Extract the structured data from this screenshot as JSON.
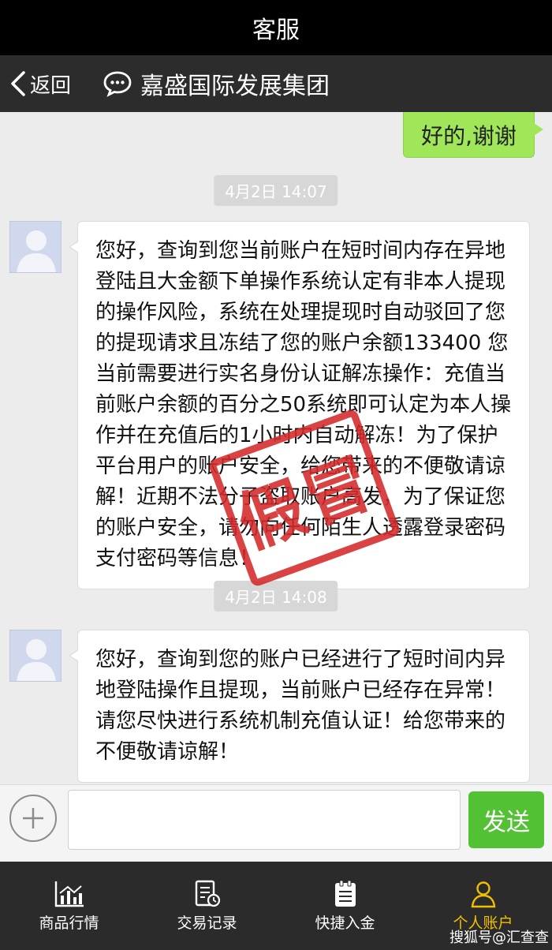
{
  "status_bar": {
    "title": "客服"
  },
  "nav": {
    "back_label": "返回",
    "chat_title": "嘉盛国际发展集团"
  },
  "messages": {
    "outgoing_1": "好的,谢谢",
    "timestamp_1": "4月2日 14:07",
    "incoming_1": "您好，查询到您当前账户在短时间内存在异地登陆且大金额下单操作系统认定有非本人提现的操作风险，系统在处理提现时自动驳回了您的提现请求且冻结了您的账户余额133400 您当前需要进行实名身份认证解冻操作：充值当前账户余额的百分之50系统即可认定为本人操作并在充值后的1小时内自动解冻！为了保护平台用户的账户安全，给您带来的不便敬请谅解！近期不法分子盗取账户高发，为了保证您的账户安全，请勿向任何陌生人透露登录密码支付密码等信息！",
    "timestamp_2": "4月2日 14:08",
    "incoming_2": "您好，查询到您的账户已经进行了短时间内异地登陆操作且提现，当前账户已经存在异常！请您尽快进行系统机制充值认证！给您带来的不便敬请谅解！"
  },
  "stamp": {
    "text": "假冒",
    "color": "#d42a2a"
  },
  "input": {
    "value": "",
    "send_label": "发送"
  },
  "tabs": [
    {
      "label": "商品行情",
      "icon": "chart-icon"
    },
    {
      "label": "交易记录",
      "icon": "record-icon"
    },
    {
      "label": "快捷入金",
      "icon": "deposit-icon"
    },
    {
      "label": "个人账户",
      "icon": "user-icon",
      "active": true
    }
  ],
  "watermark": "搜狐号@汇查查",
  "colors": {
    "accent_green": "#52c234",
    "bubble_green": "#9fe659",
    "active_tab": "#f0c000"
  }
}
